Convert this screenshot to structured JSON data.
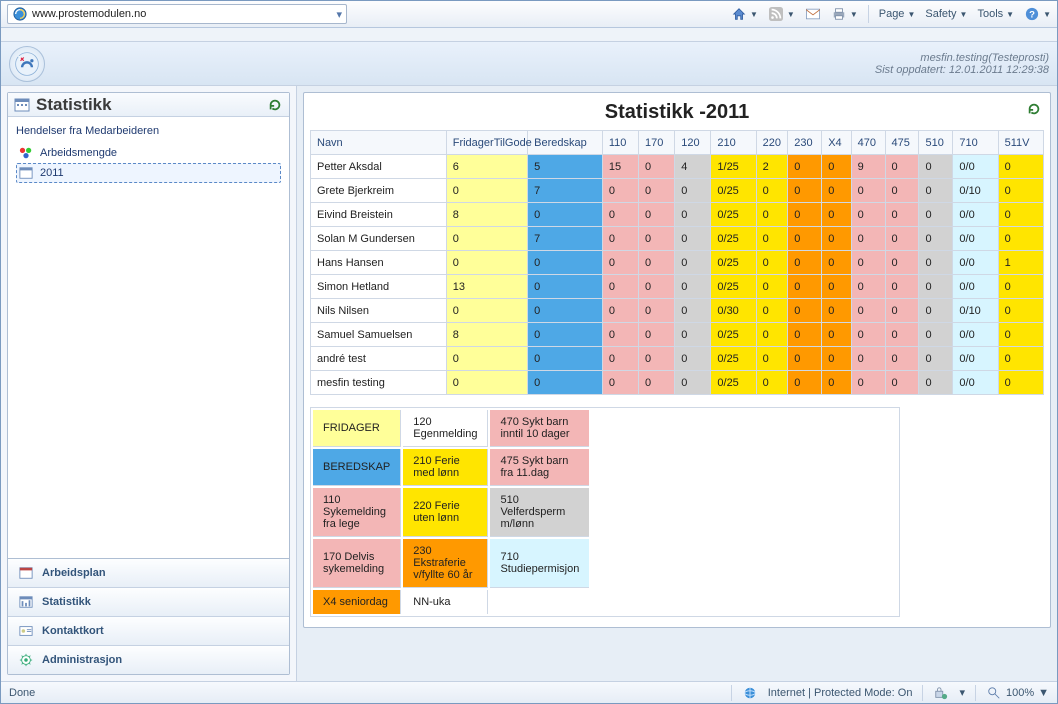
{
  "browser": {
    "url": "www.prostemodulen.no",
    "menus": {
      "page": "Page",
      "safety": "Safety",
      "tools": "Tools"
    }
  },
  "header": {
    "user": "mesfin.testing(Testeprosti)",
    "updated_prefix": "Sist oppdatert:",
    "updated": "12.01.2011 12:29:38"
  },
  "sidebar": {
    "title": "Statistikk",
    "tree": {
      "root": "Hendelser fra Medarbeideren",
      "items": [
        "Arbeidsmengde",
        "2011"
      ]
    },
    "nav": [
      "Arbeidsplan",
      "Statistikk",
      "Kontaktkort",
      "Administrasjon"
    ]
  },
  "main": {
    "title": "Statistikk -2011",
    "columns": [
      "Navn",
      "FridagerTilGode",
      "Beredskap",
      "110",
      "170",
      "120",
      "210",
      "220",
      "230",
      "X4",
      "470",
      "475",
      "510",
      "710",
      "511V"
    ],
    "col_classes": [
      "name",
      "c-yel",
      "c-blue",
      "c-pink",
      "c-pink",
      "c-grey",
      "c-yellow",
      "c-yellow",
      "c-orange",
      "c-orange",
      "c-pink",
      "c-pink",
      "c-grey",
      "c-cyan",
      "c-yellow"
    ],
    "rows": [
      {
        "name": "Petter  Aksdal",
        "cells": [
          "6",
          "5",
          "15",
          "0",
          "4",
          "1/25",
          "2",
          "0",
          "0",
          "9",
          "0",
          "0",
          "0/0",
          "0"
        ]
      },
      {
        "name": "Grete  Bjerkreim",
        "cells": [
          "0",
          "7",
          "0",
          "0",
          "0",
          "0/25",
          "0",
          "0",
          "0",
          "0",
          "0",
          "0",
          "0/10",
          "0"
        ]
      },
      {
        "name": "Eivind  Breistein",
        "cells": [
          "8",
          "0",
          "0",
          "0",
          "0",
          "0/25",
          "0",
          "0",
          "0",
          "0",
          "0",
          "0",
          "0/0",
          "0"
        ]
      },
      {
        "name": "Solan M Gundersen",
        "cells": [
          "0",
          "7",
          "0",
          "0",
          "0",
          "0/25",
          "0",
          "0",
          "0",
          "0",
          "0",
          "0",
          "0/0",
          "0"
        ]
      },
      {
        "name": "Hans  Hansen",
        "cells": [
          "0",
          "0",
          "0",
          "0",
          "0",
          "0/25",
          "0",
          "0",
          "0",
          "0",
          "0",
          "0",
          "0/0",
          "1"
        ]
      },
      {
        "name": "Simon  Hetland",
        "cells": [
          "13",
          "0",
          "0",
          "0",
          "0",
          "0/25",
          "0",
          "0",
          "0",
          "0",
          "0",
          "0",
          "0/0",
          "0"
        ]
      },
      {
        "name": "Nils  Nilsen",
        "cells": [
          "0",
          "0",
          "0",
          "0",
          "0",
          "0/30",
          "0",
          "0",
          "0",
          "0",
          "0",
          "0",
          "0/10",
          "0"
        ]
      },
      {
        "name": "Samuel  Samuelsen",
        "cells": [
          "8",
          "0",
          "0",
          "0",
          "0",
          "0/25",
          "0",
          "0",
          "0",
          "0",
          "0",
          "0",
          "0/0",
          "0"
        ]
      },
      {
        "name": "andré  test",
        "cells": [
          "0",
          "0",
          "0",
          "0",
          "0",
          "0/25",
          "0",
          "0",
          "0",
          "0",
          "0",
          "0",
          "0/0",
          "0"
        ]
      },
      {
        "name": "mesfin  testing",
        "cells": [
          "0",
          "0",
          "0",
          "0",
          "0",
          "0/25",
          "0",
          "0",
          "0",
          "0",
          "0",
          "0",
          "0/0",
          "0"
        ]
      }
    ],
    "legend": [
      [
        {
          "t": "FRIDAGER",
          "c": "c-yel"
        },
        {
          "t": "120 Egenmelding",
          "c": ""
        },
        {
          "t": "470 Sykt barn inntil 10 dager",
          "c": "c-pink"
        }
      ],
      [
        {
          "t": "BEREDSKAP",
          "c": "c-blue"
        },
        {
          "t": "210 Ferie med lønn",
          "c": "c-yellow"
        },
        {
          "t": "475 Sykt barn  fra 11.dag",
          "c": "c-pink"
        }
      ],
      [
        {
          "t": "110 Sykemelding fra lege",
          "c": "c-pink"
        },
        {
          "t": "220 Ferie uten lønn",
          "c": "c-yellow"
        },
        {
          "t": "510 Velferdsperm m/lønn",
          "c": "c-grey"
        }
      ],
      [
        {
          "t": "170 Delvis sykemelding",
          "c": "c-pink"
        },
        {
          "t": "230 Ekstraferie v/fyllte 60 år",
          "c": "c-orange"
        },
        {
          "t": "710 Studiepermisjon",
          "c": "c-cyan"
        }
      ],
      [
        {
          "t": "X4 seniordag",
          "c": "c-orange"
        },
        {
          "t": "NN-uka",
          "c": ""
        },
        {
          "t": "",
          "c": ""
        }
      ]
    ]
  },
  "statusbar": {
    "left": "Done",
    "zone": "Internet | Protected Mode: On",
    "zoom": "100%"
  }
}
